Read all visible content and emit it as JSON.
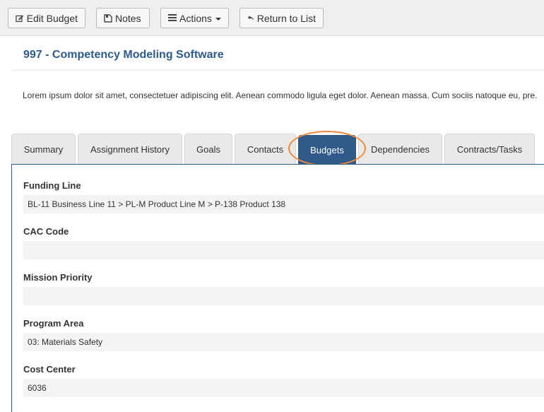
{
  "toolbar": {
    "edit_budget_label": "Edit Budget",
    "notes_label": "Notes",
    "actions_label": "Actions",
    "return_label": "Return to List"
  },
  "header": {
    "title": "997 - Competency Modeling Software",
    "description": "Lorem ipsum dolor sit amet, consectetuer adipiscing elit. Aenean commodo ligula eget dolor. Aenean massa. Cum sociis natoque eu, pre."
  },
  "tabs": {
    "summary": "Summary",
    "assignment_history": "Assignment History",
    "goals": "Goals",
    "contacts": "Contacts",
    "budgets": "Budgets",
    "dependencies": "Dependencies",
    "contracts_tasks": "Contracts/Tasks",
    "active": "Budgets"
  },
  "fields": {
    "funding_line": {
      "label": "Funding Line",
      "value": "BL-11 Business Line 11 > PL-M Product Line M > P-138 Product 138"
    },
    "cac_code": {
      "label": "CAC Code",
      "value": ""
    },
    "mission_priority": {
      "label": "Mission Priority",
      "value": ""
    },
    "program_area": {
      "label": "Program Area",
      "value": "03: Materials Safety"
    },
    "cost_center": {
      "label": "Cost Center",
      "value": "6036"
    }
  },
  "colors": {
    "accent": "#2f5a8a",
    "title": "#2d5a8c",
    "highlight": "#f08a3a"
  },
  "icons": [
    "edit-icon",
    "notes-icon",
    "list-icon",
    "return-arrow-icon"
  ]
}
